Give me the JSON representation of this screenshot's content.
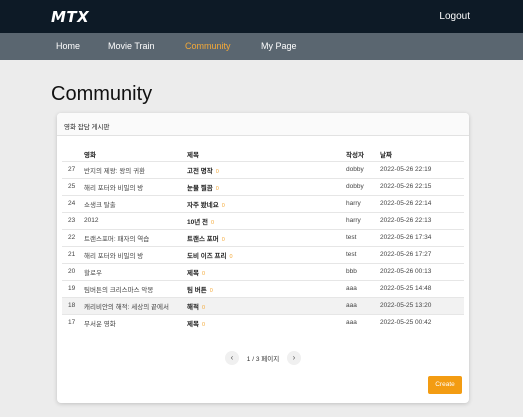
{
  "header": {
    "logo": "MTX",
    "logout_label": "Logout"
  },
  "nav": {
    "items": [
      {
        "label": "Home"
      },
      {
        "label": "Movie Train"
      },
      {
        "label": "Community"
      },
      {
        "label": "My Page"
      }
    ],
    "active": "Community"
  },
  "page": {
    "title": "Community"
  },
  "board": {
    "title": "영화 잡담 게시판",
    "columns": {
      "num": "",
      "movie": "영화",
      "title": "제목",
      "author": "작성자",
      "date": "날짜"
    },
    "rows": [
      {
        "num": "27",
        "movie": "반지의 제왕: 왕의 귀환",
        "title": "고전 명작",
        "comments": "0",
        "author": "dobby",
        "date": "2022-05-26 22:19"
      },
      {
        "num": "25",
        "movie": "해리 포터와 비밀의 방",
        "title": "눈물 찔끔",
        "comments": "0",
        "author": "dobby",
        "date": "2022-05-26 22:15"
      },
      {
        "num": "24",
        "movie": "쇼생크 탈출",
        "title": "자주 봤네요",
        "comments": "0",
        "author": "harry",
        "date": "2022-05-26 22:14"
      },
      {
        "num": "23",
        "movie": "2012",
        "title": "10년 전",
        "comments": "0",
        "author": "harry",
        "date": "2022-05-26 22:13"
      },
      {
        "num": "22",
        "movie": "트랜스포머: 패자의 역습",
        "title": "트랜스 포머",
        "comments": "0",
        "author": "test",
        "date": "2022-05-26 17:34"
      },
      {
        "num": "21",
        "movie": "해리 포터와 비밀의 방",
        "title": "도비 이즈 프리",
        "comments": "0",
        "author": "test",
        "date": "2022-05-26 17:27"
      },
      {
        "num": "20",
        "movie": "할로우",
        "title": "제목",
        "comments": "0",
        "author": "bbb",
        "date": "2022-05-26 00:13"
      },
      {
        "num": "19",
        "movie": "팀버튼의 크리스마스 악몽",
        "title": "팀 버튼",
        "comments": "0",
        "author": "aaa",
        "date": "2022-05-25 14:48"
      },
      {
        "num": "18",
        "movie": "캐리비안의 해적: 세상의 끝에서",
        "title": "해적",
        "comments": "0",
        "author": "aaa",
        "date": "2022-05-25 13:20"
      },
      {
        "num": "17",
        "movie": "무서운 영화",
        "title": "제목",
        "comments": "0",
        "author": "aaa",
        "date": "2022-05-25 00:42"
      }
    ],
    "pagination": {
      "text": "1 / 3 페이지"
    },
    "create_label": "Create"
  },
  "colors": {
    "topbar": "#0d1a26",
    "navbar": "#5a6670",
    "accent": "#f39c12",
    "active_nav": "#f4a938"
  },
  "icons": {
    "prev": "chevron-left-icon",
    "next": "chevron-right-icon"
  }
}
